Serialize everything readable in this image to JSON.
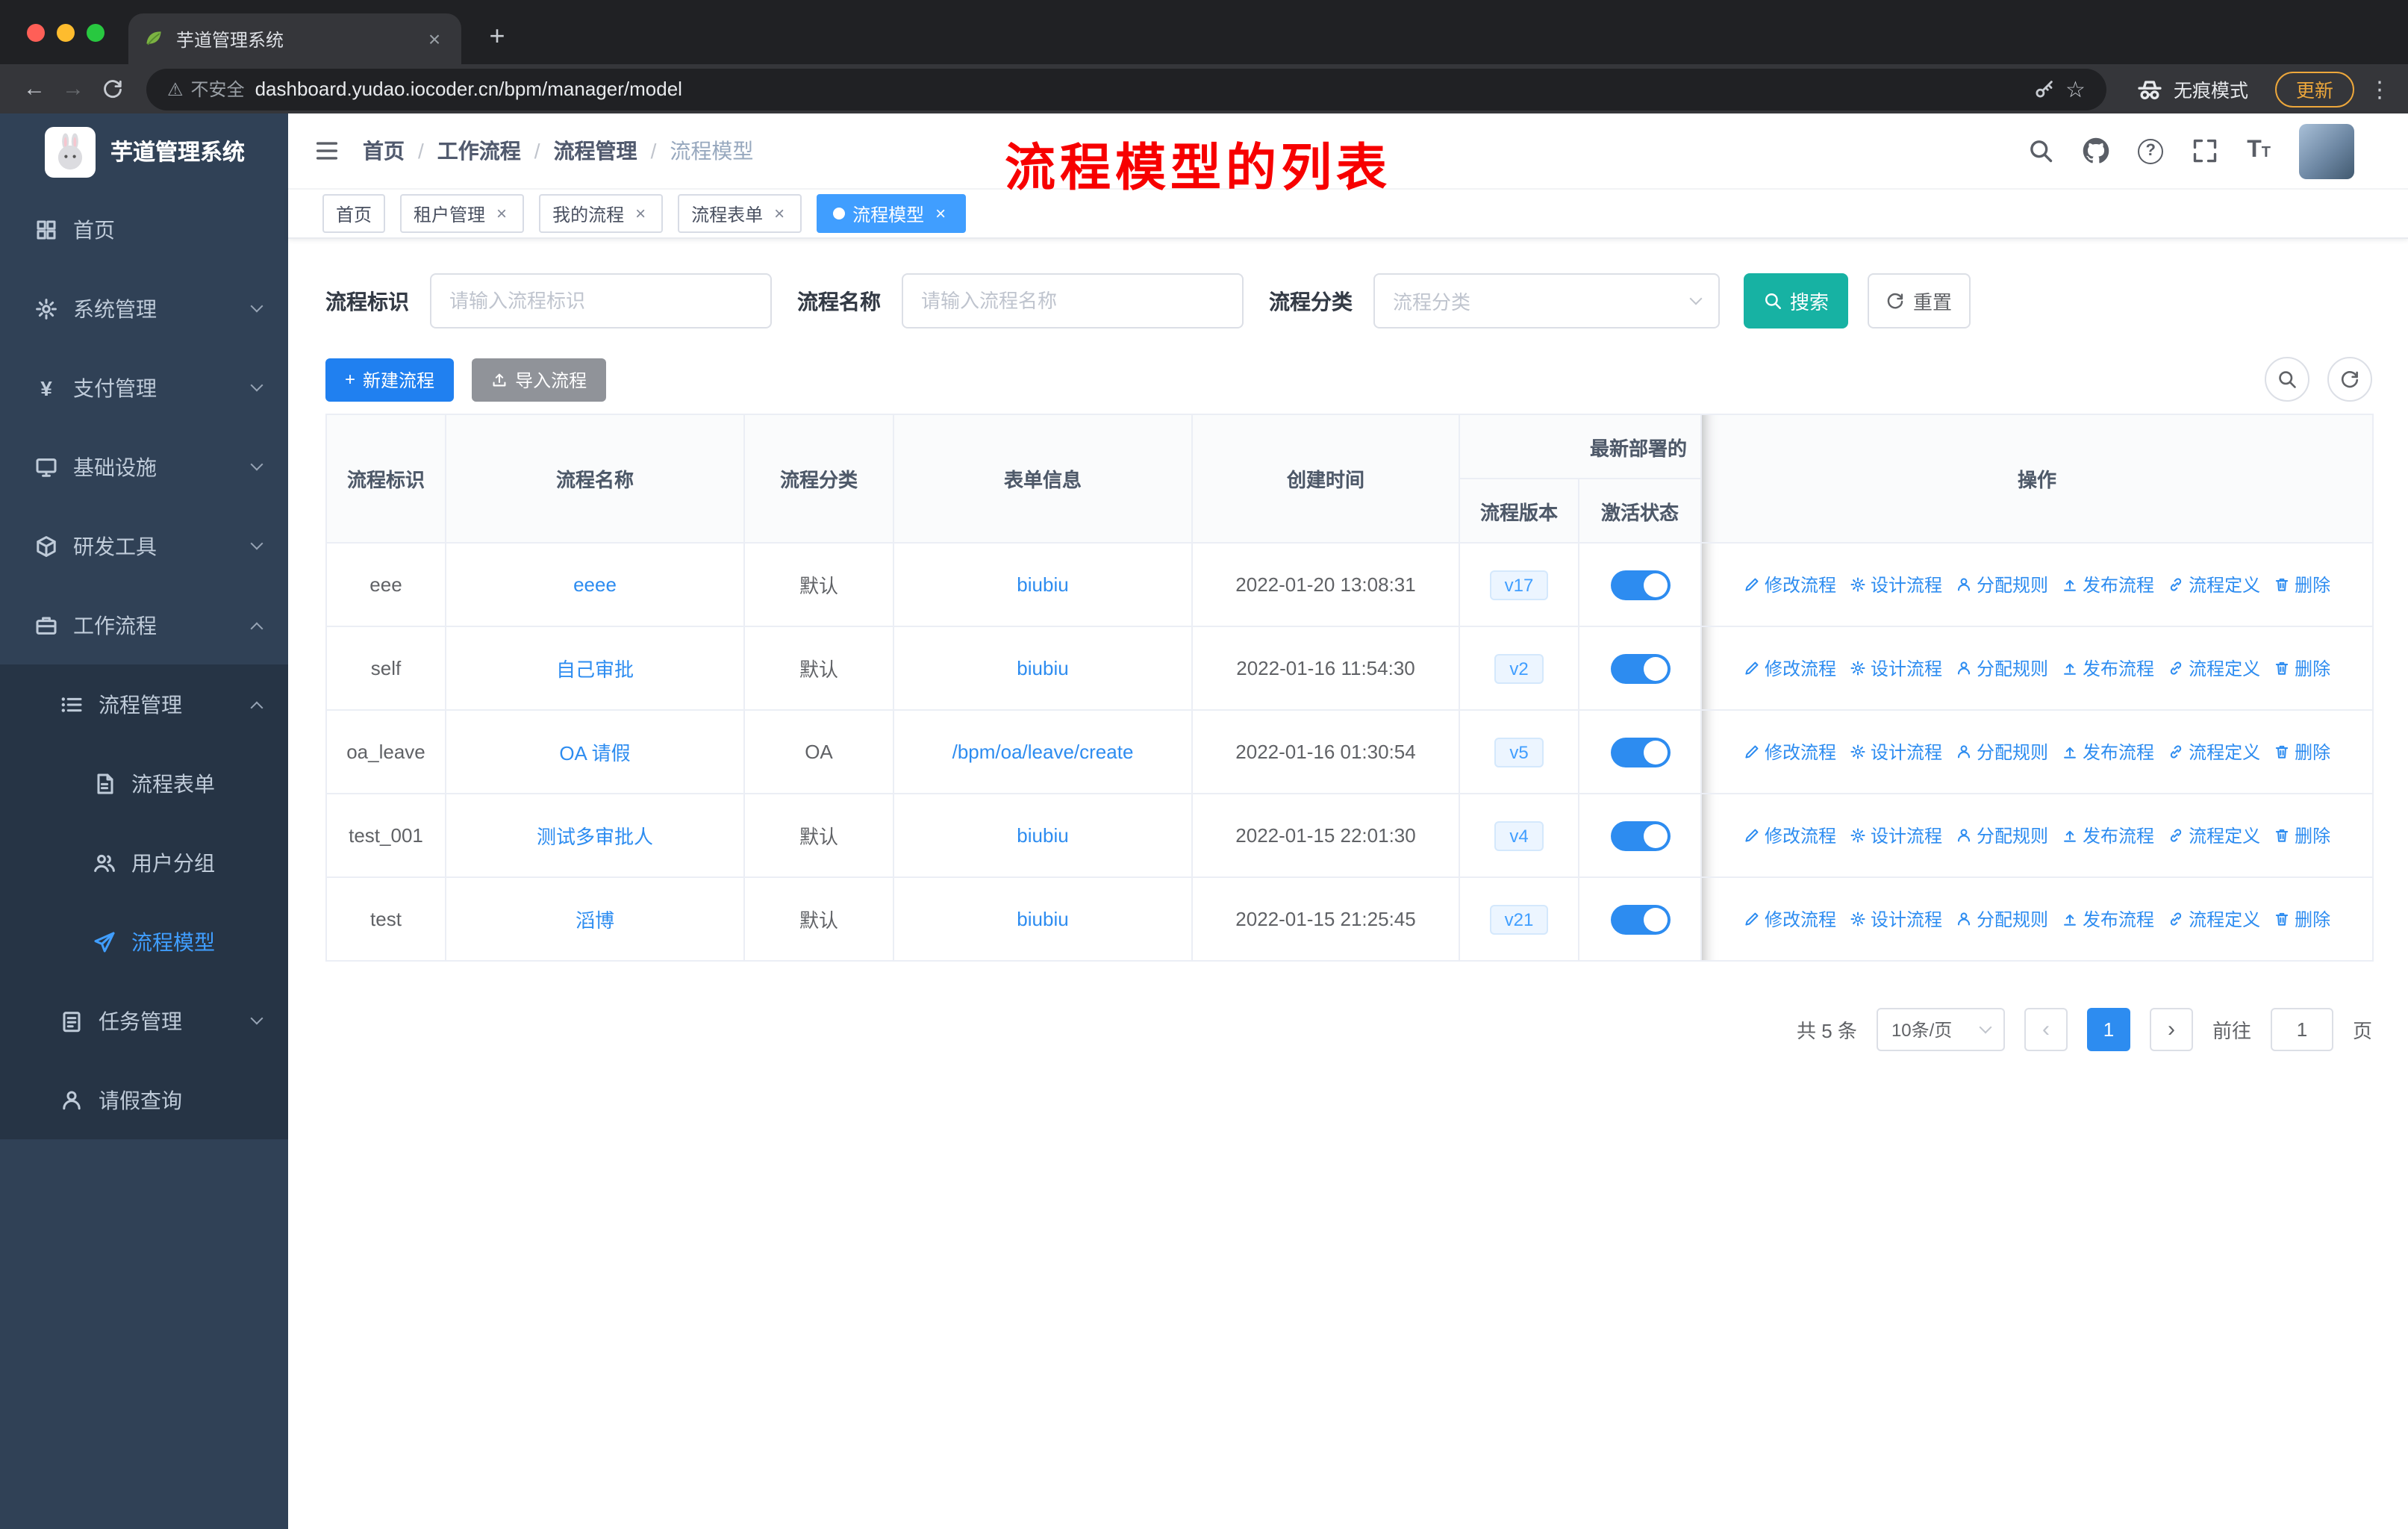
{
  "glyphs": {
    "close": "×",
    "plus": "+",
    "kebab": "⋮",
    "warning_triangle": "⚠",
    "star": "☆",
    "question_mark": "?",
    "slash": "/",
    "back_arrow": "←",
    "forward_arrow": "→",
    "prev_arrow": "‹",
    "next_arrow": "›",
    "yen": "¥",
    "letter_T": "T"
  },
  "browser": {
    "tab_title": "芋道管理系统",
    "security_label": "不安全",
    "url": "dashboard.yudao.iocoder.cn/bpm/manager/model",
    "incognito_label": "无痕模式",
    "update_label": "更新"
  },
  "sidebar": {
    "logo_title": "芋道管理系统",
    "menu": [
      "首页",
      "系统管理",
      "支付管理",
      "基础设施",
      "研发工具",
      "工作流程",
      "流程管理",
      "流程表单",
      "用户分组",
      "流程模型",
      "任务管理",
      "请假查询"
    ]
  },
  "header": {
    "breadcrumb": [
      "首页",
      "工作流程",
      "流程管理",
      "流程模型"
    ],
    "annotation": "流程模型的列表"
  },
  "tabs": [
    "首页",
    "租户管理",
    "我的流程",
    "流程表单",
    "流程模型"
  ],
  "filters": {
    "key_label": "流程标识",
    "key_placeholder": "请输入流程标识",
    "name_label": "流程名称",
    "name_placeholder": "请输入流程名称",
    "category_label": "流程分类",
    "category_placeholder": "流程分类",
    "search_label": "搜索",
    "reset_label": "重置"
  },
  "toolbar": {
    "create_label": "新建流程",
    "import_label": "导入流程"
  },
  "table": {
    "headers": {
      "key": "流程标识",
      "name": "流程名称",
      "category": "流程分类",
      "form": "表单信息",
      "created": "创建时间",
      "deploy_group": "最新部署的",
      "version": "流程版本",
      "active": "激活状态",
      "actions": "操作"
    },
    "action_labels": [
      "修改流程",
      "设计流程",
      "分配规则",
      "发布流程",
      "流程定义",
      "删除"
    ],
    "rows": [
      {
        "key": "eee",
        "name": "eeee",
        "category": "默认",
        "form": "biubiu",
        "created": "2022-01-20 13:08:31",
        "version": "v17",
        "active": true
      },
      {
        "key": "self",
        "name": "自己审批",
        "category": "默认",
        "form": "biubiu",
        "created": "2022-01-16 11:54:30",
        "version": "v2",
        "active": true
      },
      {
        "key": "oa_leave",
        "name": "OA 请假",
        "category": "OA",
        "form": "/bpm/oa/leave/create",
        "created": "2022-01-16 01:30:54",
        "version": "v5",
        "active": true
      },
      {
        "key": "test_001",
        "name": "测试多审批人",
        "category": "默认",
        "form": "biubiu",
        "created": "2022-01-15 22:01:30",
        "version": "v4",
        "active": true
      },
      {
        "key": "test",
        "name": "滔博",
        "category": "默认",
        "form": "biubiu",
        "created": "2022-01-15 21:25:45",
        "version": "v21",
        "active": true
      }
    ]
  },
  "pagination": {
    "total": "共 5 条",
    "page_size": "10条/页",
    "page": "1",
    "goto_label": "前往",
    "goto_value": "1",
    "unit_label": "页"
  },
  "colors": {
    "primary_blue": "#2d8cf0",
    "active_menu_blue": "#409eff",
    "search_button_teal": "#17b2a3",
    "annotation_red": "#f70000",
    "sidebar_bg": "#304156",
    "submenu_bg": "#263445",
    "toggle_on": "#2d8cf0"
  }
}
